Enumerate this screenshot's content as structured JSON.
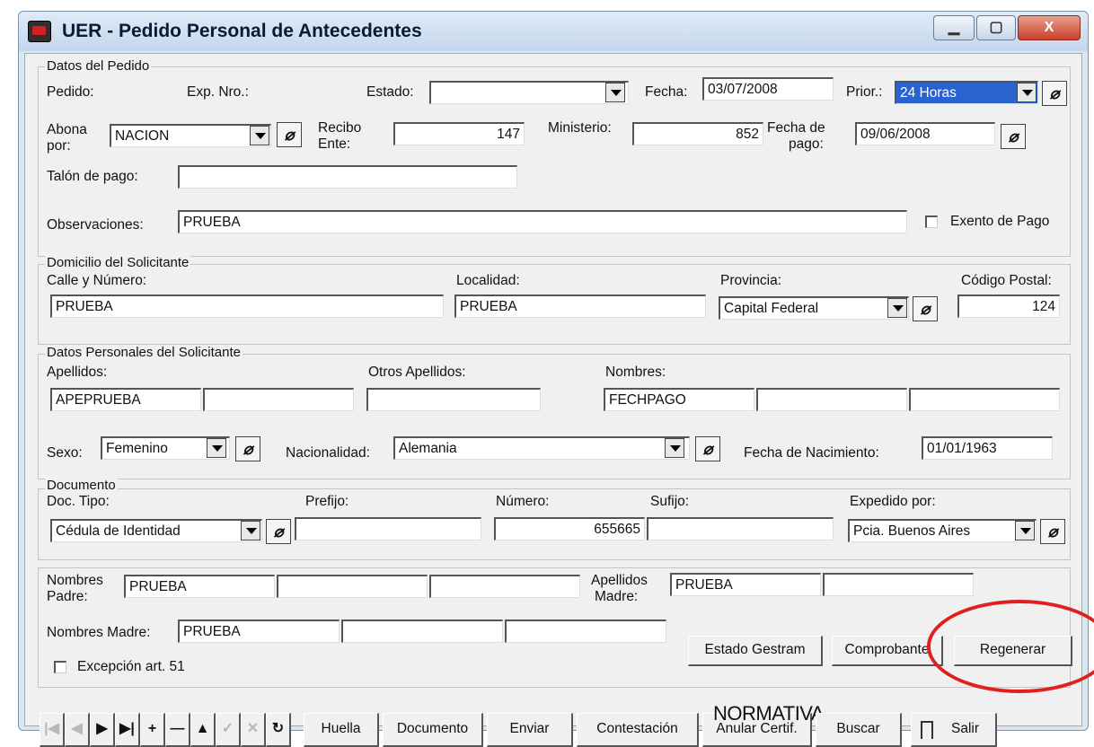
{
  "window": {
    "title": "UER - Pedido Personal de Antecedentes",
    "caption_buttons": {
      "minimize": "▁",
      "maximize": "▢",
      "close": "X"
    }
  },
  "datos_pedido": {
    "legend": "Datos del Pedido",
    "pedido_label": "Pedido:",
    "exp_label": "Exp. Nro.:",
    "estado_label": "Estado:",
    "estado_value": "",
    "fecha_label": "Fecha:",
    "fecha_value": "03/07/2008",
    "prior_label": "Prior.:",
    "prior_value": "24 Horas",
    "abona_label_1": "Abona",
    "abona_label_2": "por:",
    "abona_value": "NACION",
    "recibo_label_1": "Recibo",
    "recibo_label_2": "Ente:",
    "recibo_value": "147",
    "ministerio_label": "Ministerio:",
    "ministerio_value": "852",
    "fecha_pago_label_1": "Fecha de",
    "fecha_pago_label_2": "pago:",
    "fecha_pago_value": "09/06/2008",
    "talon_label": "Talón de pago:",
    "talon_value": "",
    "observaciones_label": "Observaciones:",
    "observaciones_value": "PRUEBA",
    "exento_label": "Exento de Pago"
  },
  "domicilio": {
    "legend": "Domicilio del Solicitante",
    "calle_label": "Calle y Número:",
    "calle_value": "PRUEBA",
    "localidad_label": "Localidad:",
    "localidad_value": "PRUEBA",
    "provincia_label": "Provincia:",
    "provincia_value": "Capital Federal",
    "cp_label": "Código Postal:",
    "cp_value": "124"
  },
  "datos_personales": {
    "legend": "Datos Personales del Solicitante",
    "apellidos_label": "Apellidos:",
    "apellido_1": "APEPRUEBA",
    "apellido_2": "",
    "otros_apellidos_label": "Otros Apellidos:",
    "otros_apellidos": "",
    "nombres_label": "Nombres:",
    "nombre_1": "FECHPAGO",
    "nombre_2": "",
    "nombre_3": "",
    "sexo_label": "Sexo:",
    "sexo_value": "Femenino",
    "nacionalidad_label": "Nacionalidad:",
    "nacionalidad_value": "Alemania",
    "fecha_nac_label": "Fecha de Nacimiento:",
    "fecha_nac_value": "01/01/1963"
  },
  "documento": {
    "legend": "Documento",
    "tipo_label": "Doc. Tipo:",
    "tipo_value": "Cédula de Identidad",
    "prefijo_label": "Prefijo:",
    "prefijo_value": "",
    "numero_label": "Número:",
    "numero_value": "655665",
    "sufijo_label": "Sufijo:",
    "sufijo_value": "",
    "expedido_label": "Expedido por:",
    "expedido_value": "Pcia. Buenos Aires"
  },
  "padres": {
    "nombres_padre_label_1": "Nombres",
    "nombres_padre_label_2": "Padre:",
    "padre_1": "PRUEBA",
    "padre_2": "",
    "padre_3": "",
    "apellidos_madre_label_1": "Apellidos",
    "apellidos_madre_label_2": "Madre:",
    "madre_apellido_1": "PRUEBA",
    "madre_apellido_2": "",
    "nombres_madre_label": "Nombres Madre:",
    "madre_nombre_1": "PRUEBA",
    "madre_nombre_2": "",
    "madre_nombre_3": "",
    "excepcion_label": "Excepción art. 51"
  },
  "actions": {
    "estado_gestram": "Estado Gestram",
    "comprobante": "Comprobante",
    "regenerar": "Regenerar"
  },
  "toolbar": {
    "nav_first": "|◀",
    "nav_prev": "◀",
    "nav_next": "▶",
    "nav_last": "▶|",
    "nav_add": "+",
    "nav_delete": "—",
    "nav_up": "▲",
    "nav_confirm": "✓",
    "nav_cancel": "✕",
    "nav_refresh": "↻",
    "huella": "Huella",
    "documento": "Documento",
    "enviar": "Enviar",
    "contestacion": "Contestación",
    "anular": "Anular Certif.",
    "buscar": "Buscar",
    "salir": "Salir",
    "normativa_overlay": "NORMATIVA"
  },
  "colors": {
    "highlight": "#e01f1f",
    "selection": "#2a63d0"
  }
}
